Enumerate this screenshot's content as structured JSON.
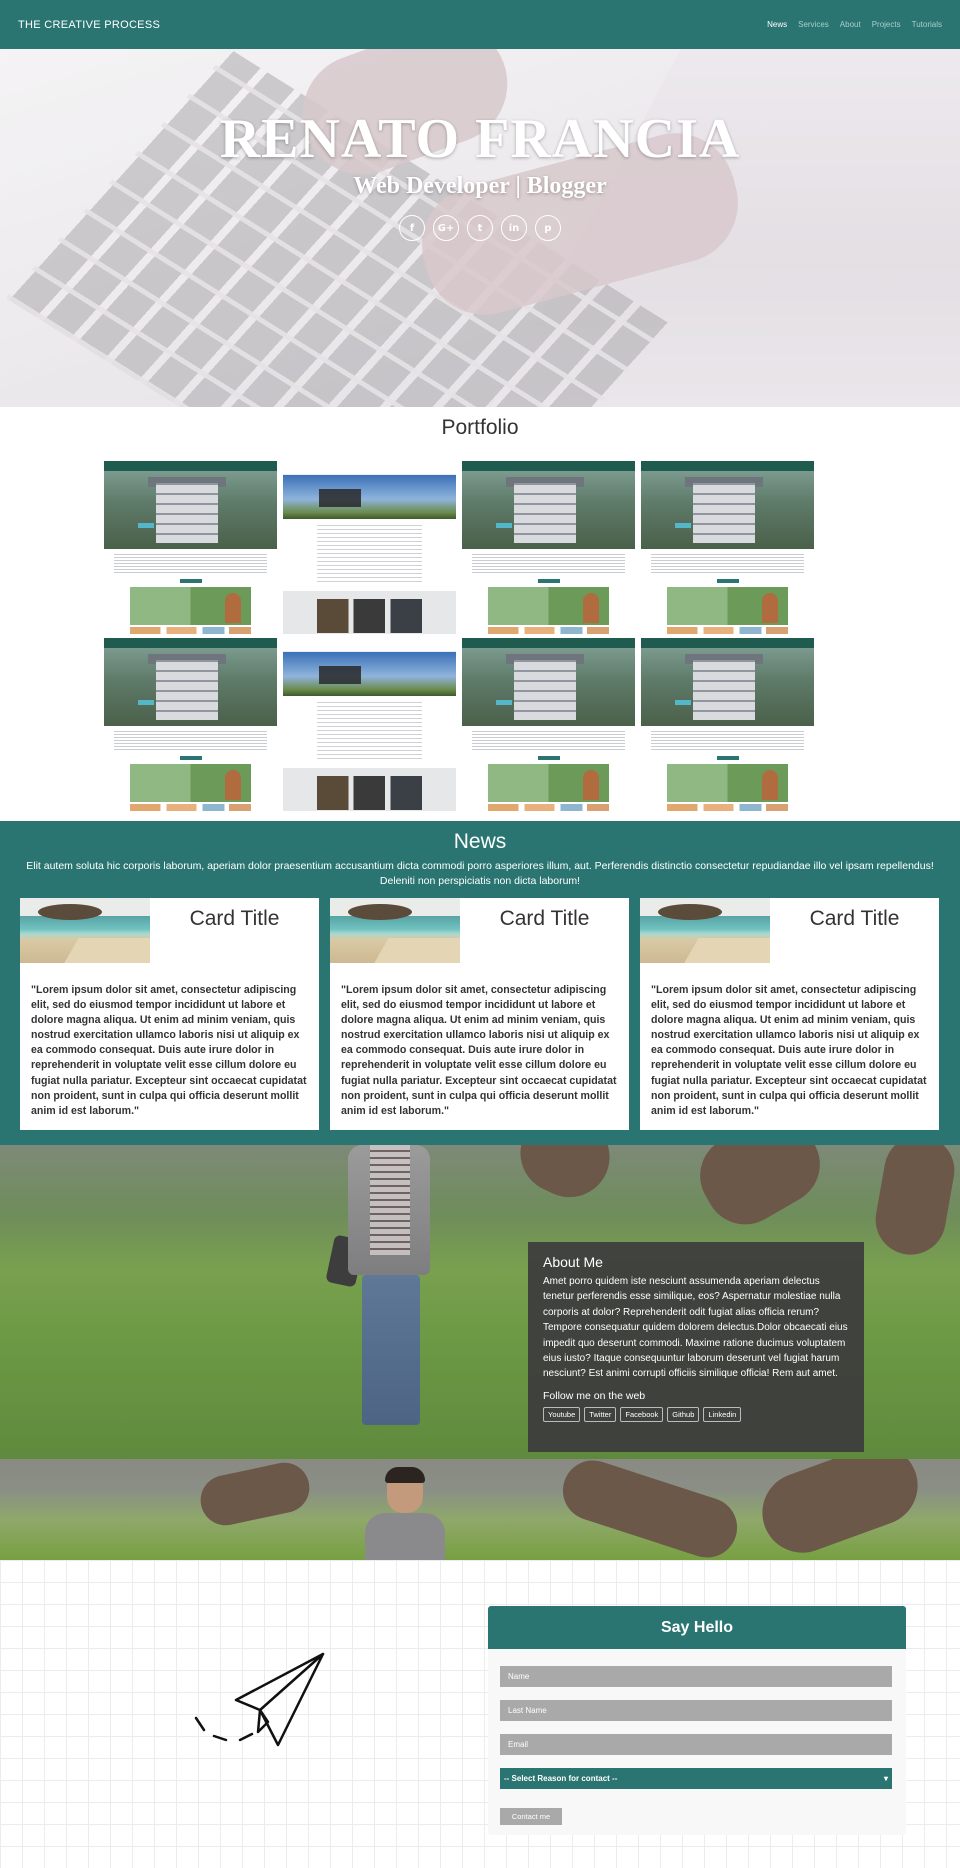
{
  "navbar": {
    "brand": "THE CREATIVE PROCESS",
    "links": [
      "News",
      "Services",
      "About",
      "Projects",
      "Tutorials"
    ]
  },
  "hero": {
    "name": "RENATO FRANCIA",
    "subtitle": "Web Developer | Blogger",
    "social_icons": [
      "facebook-icon",
      "google-plus-icon",
      "twitter-icon",
      "linkedin-icon",
      "pinterest-icon"
    ],
    "social_glyphs": [
      "f",
      "G+",
      "t",
      "in",
      "p"
    ]
  },
  "portfolio": {
    "title": "Portfolio"
  },
  "news": {
    "title": "News",
    "description": "Elit autem soluta hic corporis laborum, aperiam dolor praesentium accusantium dicta commodi porro asperiores illum, aut. Perferendis distinctio consectetur repudiandae illo vel ipsam repellendus! Deleniti non perspiciatis non dicta laborum!",
    "cards": [
      {
        "title": "Card Title",
        "text": "\"Lorem ipsum dolor sit amet, consectetur adipiscing elit, sed do eiusmod tempor incididunt ut labore et dolore magna aliqua. Ut enim ad minim veniam, quis nostrud exercitation ullamco laboris nisi ut aliquip ex ea commodo consequat. Duis aute irure dolor in reprehenderit in voluptate velit esse cillum dolore eu fugiat nulla pariatur. Excepteur sint occaecat cupidatat non proident, sunt in culpa qui officia deserunt mollit anim id est laborum.\""
      },
      {
        "title": "Card Title",
        "text": "\"Lorem ipsum dolor sit amet, consectetur adipiscing elit, sed do eiusmod tempor incididunt ut labore et dolore magna aliqua. Ut enim ad minim veniam, quis nostrud exercitation ullamco laboris nisi ut aliquip ex ea commodo consequat. Duis aute irure dolor in reprehenderit in voluptate velit esse cillum dolore eu fugiat nulla pariatur. Excepteur sint occaecat cupidatat non proident, sunt in culpa qui officia deserunt mollit anim id est laborum.\""
      },
      {
        "title": "Card Title",
        "text": "\"Lorem ipsum dolor sit amet, consectetur adipiscing elit, sed do eiusmod tempor incididunt ut labore et dolore magna aliqua. Ut enim ad minim veniam, quis nostrud exercitation ullamco laboris nisi ut aliquip ex ea commodo consequat. Duis aute irure dolor in reprehenderit in voluptate velit esse cillum dolore eu fugiat nulla pariatur. Excepteur sint occaecat cupidatat non proident, sunt in culpa qui officia deserunt mollit anim id est laborum.\""
      }
    ]
  },
  "about": {
    "title": "About Me",
    "text": "Amet porro quidem iste nesciunt assumenda aperiam delectus tenetur perferendis esse similique, eos? Aspernatur molestiae nulla corporis at dolor? Reprehenderit odit fugiat alias officia rerum? Tempore consequatur quidem dolorem delectus.Dolor obcaecati eius impedit quo deserunt commodi. Maxime ratione ducimus voluptatem eius iusto? Itaque consequuntur laborum deserunt vel fugiat harum nesciunt? Est animi corrupti officiis similique officia! Rem aut amet.",
    "follow_label": "Follow me on the web",
    "links": [
      "Youtube",
      "Twitter",
      "Facebook",
      "Github",
      "Linkedin"
    ]
  },
  "contact": {
    "title": "Say Hello",
    "name_placeholder": "Name",
    "last_name_placeholder": "Last Name",
    "email_placeholder": "Email",
    "reason_selected": "-- Select Reason for contact --",
    "submit_label": "Contact me"
  },
  "colors": {
    "primary": "#2a7571",
    "about_box": "#3c3c3c",
    "input_grey": "#a9a9a9"
  }
}
